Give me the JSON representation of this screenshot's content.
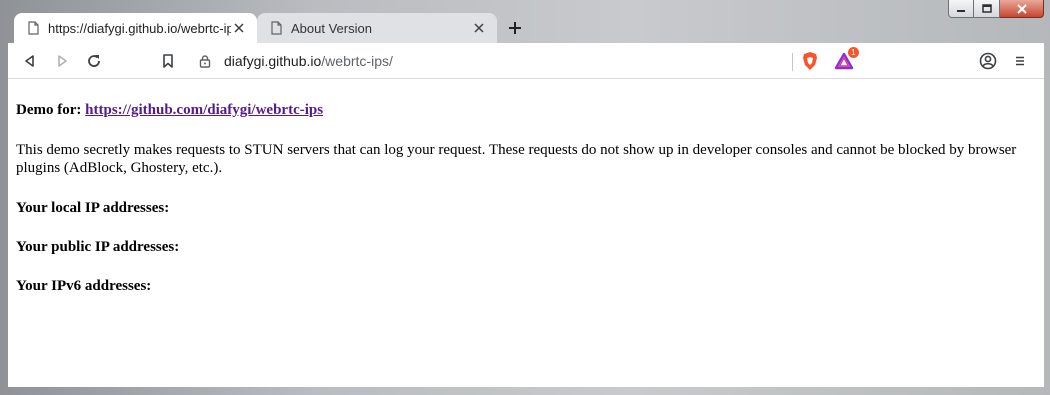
{
  "window": {
    "caption_buttons": [
      "minimize",
      "maximize",
      "close"
    ]
  },
  "tabs": [
    {
      "title": "https://diafygi.github.io/webrtc-ips/",
      "active": true,
      "icon": "page-icon"
    },
    {
      "title": "About Version",
      "active": false,
      "icon": "page-icon"
    }
  ],
  "toolbar": {
    "back_icon": "back-icon",
    "forward_icon": "forward-icon",
    "reload_icon": "reload-icon",
    "bookmark_icon": "bookmark-icon",
    "url_host": "diafygi.github.io",
    "url_path": "/webrtc-ips/",
    "brave_shield_icon": "brave-shield-icon",
    "rewards_badge_count": "1",
    "profile_icon": "profile-icon",
    "menu_icon": "menu-icon"
  },
  "content": {
    "demo_label": "Demo for: ",
    "demo_link": "https://github.com/diafygi/webrtc-ips",
    "description": "This demo secretly makes requests to STUN servers that can log your request. These requests do not show up in developer consoles and cannot be blocked by browser plugins (AdBlock, Ghostery, etc.).",
    "local_ip_label": "Your local IP addresses:",
    "public_ip_label": "Your public IP addresses:",
    "ipv6_label": "Your IPv6 addresses:"
  },
  "colors": {
    "link": "#551a8b",
    "brave_orange": "#fb542b",
    "close_red": "#c6462f"
  }
}
